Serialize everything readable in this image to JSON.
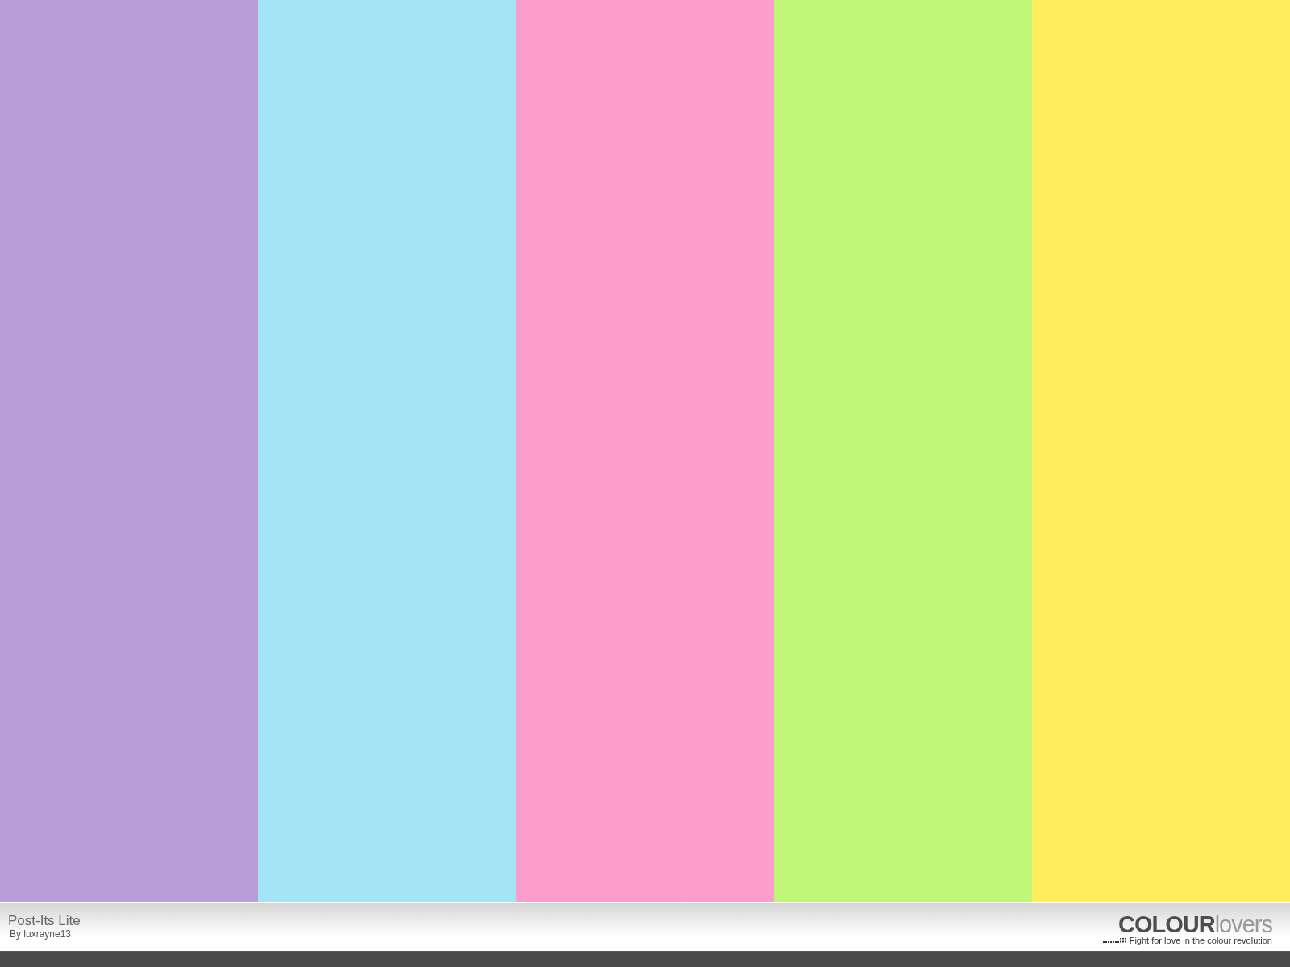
{
  "swatches": [
    {
      "color": "#b99dd8"
    },
    {
      "color": "#a3e4f6"
    },
    {
      "color": "#fb9ecc"
    },
    {
      "color": "#c1f779"
    },
    {
      "color": "#ffed5d"
    }
  ],
  "footer": {
    "title": "Post-Its Lite",
    "author": "By luxrayne13",
    "logo": {
      "bold": "COLOUR",
      "light": "lovers"
    },
    "tagline": "Fight for love in the colour revolution"
  }
}
